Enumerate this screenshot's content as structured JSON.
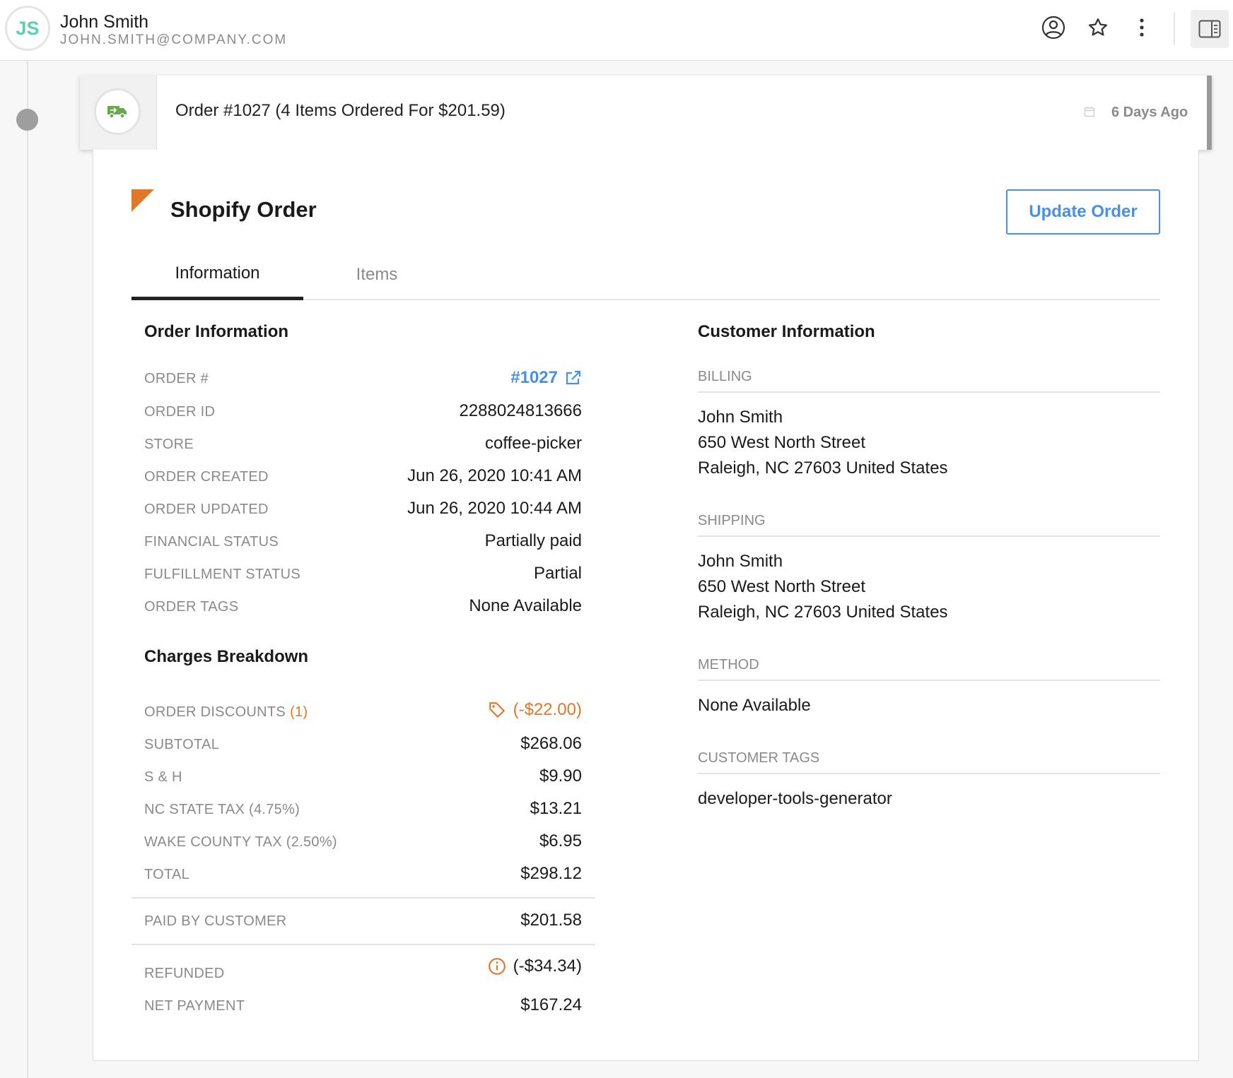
{
  "header": {
    "initials": "JS",
    "name": "John Smith",
    "email": "JOHN.SMITH@COMPANY.COM",
    "icons": [
      "user-circle-icon",
      "star-icon",
      "more-vertical-icon",
      "panel-toggle-icon"
    ]
  },
  "event": {
    "icon": "delivery-truck-icon",
    "title": "Order #1027 (4 Items Ordered For $201.59)",
    "date": "6 Days Ago"
  },
  "panel": {
    "title": "Shopify Order",
    "update_button": "Update Order",
    "tabs": [
      "Information",
      "Items"
    ],
    "active_tab": "Information"
  },
  "order_info": {
    "heading": "Order Information",
    "rows": [
      {
        "label": "ORDER #",
        "value": "#1027"
      },
      {
        "label": "ORDER ID",
        "value": "2288024813666"
      },
      {
        "label": "STORE",
        "value": "coffee-picker"
      },
      {
        "label": "ORDER CREATED",
        "value": "Jun 26, 2020 10:41 AM"
      },
      {
        "label": "ORDER UPDATED",
        "value": "Jun 26, 2020 10:44 AM"
      },
      {
        "label": "FINANCIAL STATUS",
        "value": "Partially paid"
      },
      {
        "label": "FULFILLMENT STATUS",
        "value": "Partial"
      },
      {
        "label": "ORDER TAGS",
        "value": "None Available"
      }
    ]
  },
  "charges": {
    "heading": "Charges Breakdown",
    "discounts": {
      "label": "ORDER DISCOUNTS",
      "count": "(1)",
      "value": "(-$22.00)"
    },
    "rows": [
      {
        "label": "SUBTOTAL",
        "value": "$268.06"
      },
      {
        "label": "S & H",
        "value": "$9.90"
      },
      {
        "label": "NC STATE TAX (4.75%)",
        "value": "$13.21"
      },
      {
        "label": "WAKE COUNTY TAX (2.50%)",
        "value": "$6.95"
      },
      {
        "label": "TOTAL",
        "value": "$298.12"
      }
    ],
    "paid": {
      "label": "PAID BY CUSTOMER",
      "value": "$201.58"
    },
    "refunded": {
      "label": "REFUNDED",
      "value": "(-$34.34)"
    },
    "net": {
      "label": "NET PAYMENT",
      "value": "$167.24"
    }
  },
  "customer": {
    "heading": "Customer Information",
    "billing": {
      "label": "BILLING",
      "lines": [
        "John Smith",
        "650 West North Street",
        "Raleigh, NC 27603 United States"
      ]
    },
    "shipping": {
      "label": "SHIPPING",
      "lines": [
        "John Smith",
        "650 West North Street",
        "Raleigh, NC 27603 United States"
      ]
    },
    "method": {
      "label": "METHOD",
      "value": "None Available"
    },
    "tags": {
      "label": "CUSTOMER TAGS",
      "value": "developer-tools-generator"
    }
  },
  "colors": {
    "accent": "#4a90e2",
    "orange": "#e0782c",
    "avatar": "#5ecfb0",
    "truck": "#6aa84f"
  }
}
